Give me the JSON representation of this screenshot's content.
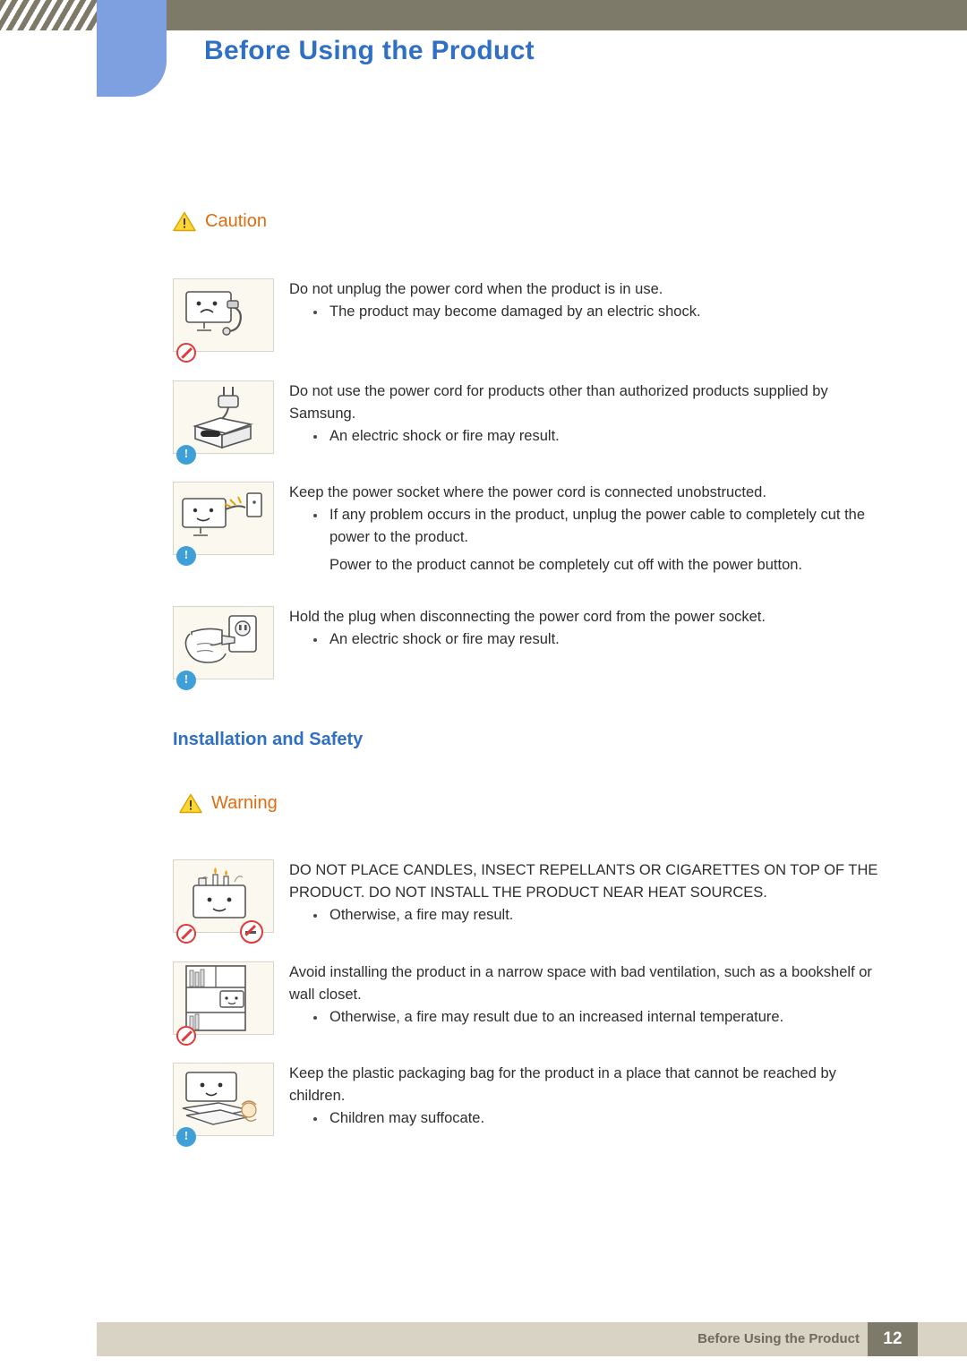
{
  "header": {
    "title": "Before Using the Product"
  },
  "notices": {
    "caution_label": "Caution",
    "warning_label": "Warning"
  },
  "sections": {
    "installation_safety": "Installation and Safety"
  },
  "caution_items": [
    {
      "icon": "monitor-unplug-prohibited-icon",
      "badge": "prohibit",
      "lines": [
        {
          "type": "plain",
          "text": "Do not unplug the power cord when the product is in use."
        },
        {
          "type": "bullet",
          "text": "The product may become damaged by an electric shock."
        }
      ]
    },
    {
      "icon": "power-cord-samsung-box-icon",
      "badge": "info",
      "lines": [
        {
          "type": "plain",
          "text": "Do not use the power cord for products other than authorized products supplied by Samsung."
        },
        {
          "type": "bullet",
          "text": "An electric shock or fire may result."
        }
      ]
    },
    {
      "icon": "monitor-power-socket-icon",
      "badge": "info",
      "lines": [
        {
          "type": "plain",
          "text": "Keep the power socket where the power cord is connected unobstructed."
        },
        {
          "type": "bullet",
          "text": "If any problem occurs in the product, unplug the power cable to completely cut the power to the product."
        },
        {
          "type": "indent",
          "text": "Power to the product cannot be completely cut off with the power button."
        }
      ]
    },
    {
      "icon": "hand-holding-plug-icon",
      "badge": "info",
      "lines": [
        {
          "type": "plain",
          "text": "Hold the plug when disconnecting the power cord from the power socket."
        },
        {
          "type": "bullet",
          "text": "An electric shock or fire may result."
        }
      ]
    }
  ],
  "warning_items": [
    {
      "icon": "monitor-candles-cigarettes-icon",
      "badge": "prohibit-double",
      "lines": [
        {
          "type": "plain",
          "text": "DO NOT PLACE CANDLES, INSECT REPELLANTS OR CIGARETTES ON TOP OF THE PRODUCT. DO NOT INSTALL THE PRODUCT NEAR HEAT SOURCES."
        },
        {
          "type": "bullet",
          "text": "Otherwise, a fire may result."
        }
      ]
    },
    {
      "icon": "monitor-in-bookshelf-icon",
      "badge": "prohibit",
      "lines": [
        {
          "type": "plain",
          "text": "Avoid installing the product in a narrow space with bad ventilation, such as a bookshelf or wall closet."
        },
        {
          "type": "bullet",
          "text": "Otherwise, a fire may result due to an increased internal temperature."
        }
      ]
    },
    {
      "icon": "plastic-bag-child-icon",
      "badge": "info",
      "lines": [
        {
          "type": "plain",
          "text": "Keep the plastic packaging bag for the product in a place that cannot be reached by children."
        },
        {
          "type": "bullet",
          "text": "Children may suffocate."
        }
      ]
    }
  ],
  "footer": {
    "text": "Before Using the Product",
    "page": "12"
  },
  "colors": {
    "header_band": "#7d7a6a",
    "blue_tab": "#7e9fe0",
    "title_blue": "#2f6fc4",
    "caution_orange": "#e06c10",
    "footer_band": "#d8d3c4"
  }
}
